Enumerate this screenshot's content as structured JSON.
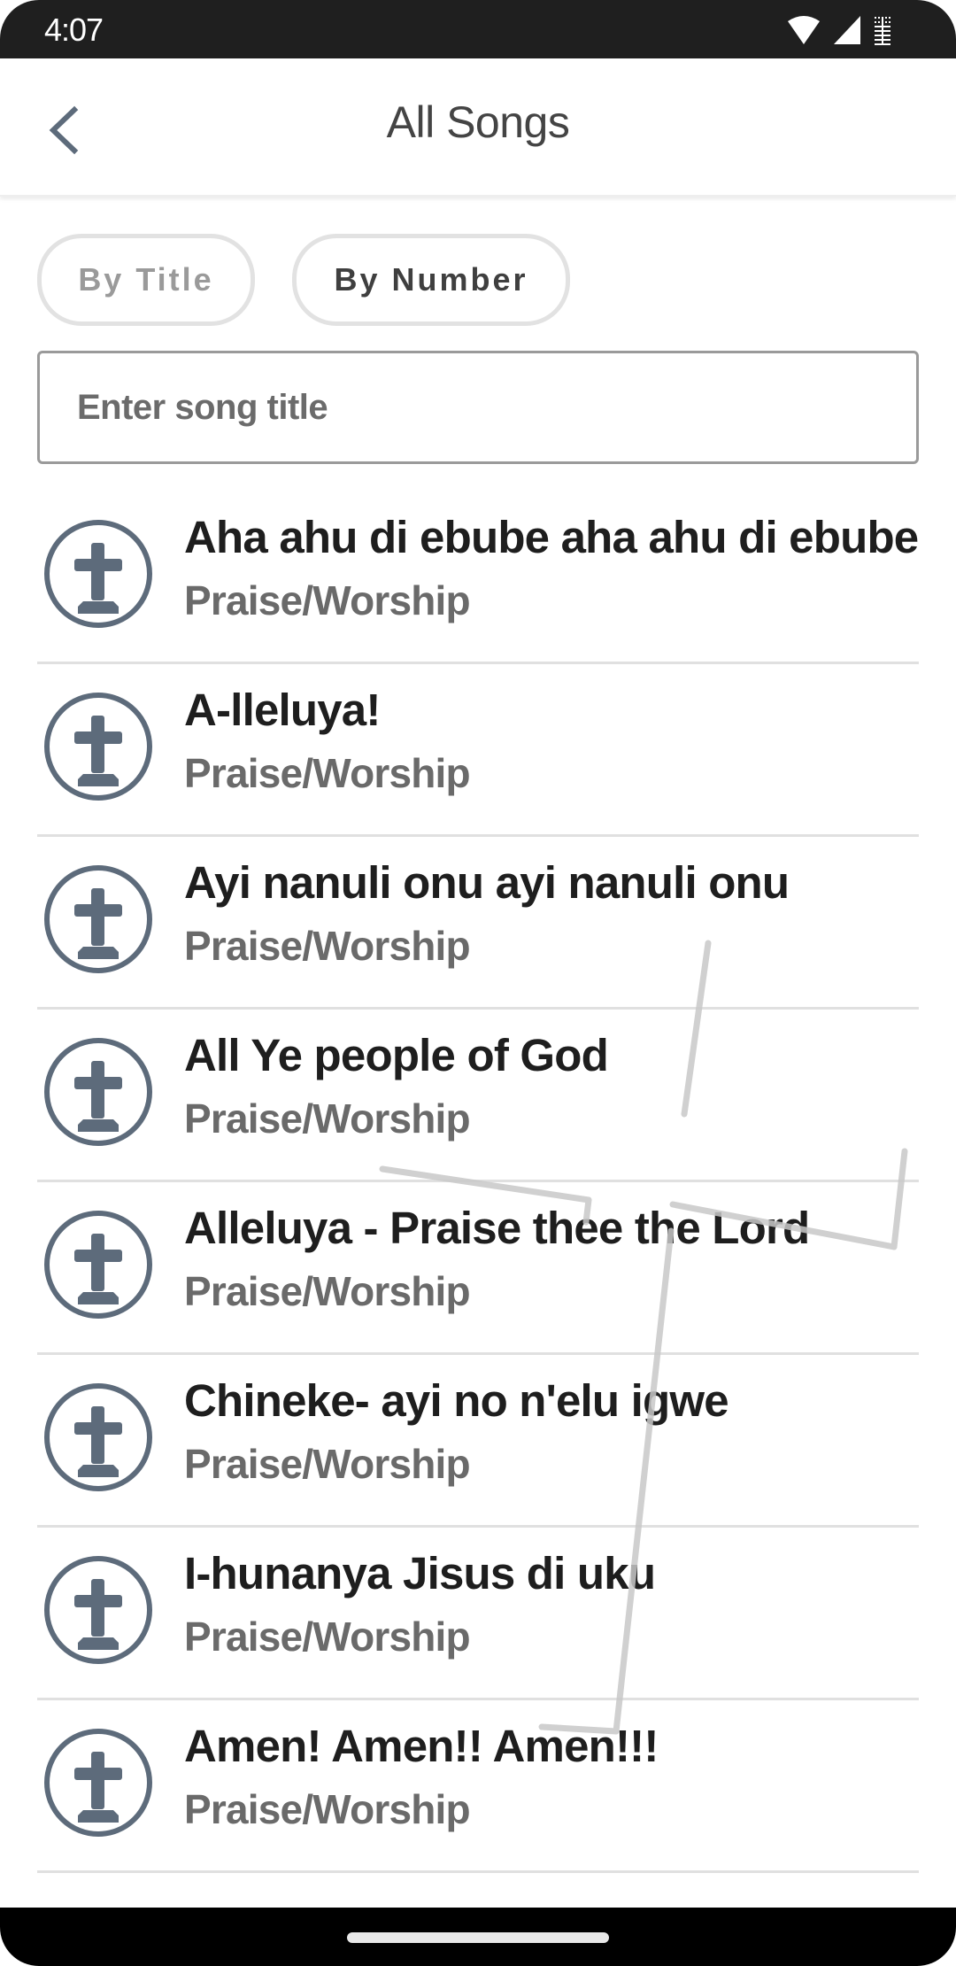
{
  "status_bar": {
    "time": "4:07",
    "icons": [
      "wifi-icon",
      "cell-signal-icon",
      "battery-icon"
    ]
  },
  "header": {
    "back_icon": "chevron-left-icon",
    "title": "All Songs"
  },
  "filters": {
    "by_title_label": "By Title",
    "by_number_label": "By Number",
    "active": "By Number"
  },
  "search": {
    "placeholder": "Enter song title",
    "value": ""
  },
  "colors": {
    "icon": "#5d6b7b",
    "title_text": "#1e1e1e",
    "category_text": "#6a6a6a",
    "divider": "#e0e0e0"
  },
  "songs": [
    {
      "title": "Aha ahu di ebube aha ahu di ebube",
      "category": "Praise/Worship",
      "icon": "cross-icon"
    },
    {
      "title": "A-lleluya!",
      "category": "Praise/Worship",
      "icon": "cross-icon"
    },
    {
      "title": "Ayi nanuli onu ayi nanuli onu",
      "category": "Praise/Worship",
      "icon": "cross-icon"
    },
    {
      "title": "All Ye people of God",
      "category": "Praise/Worship",
      "icon": "cross-icon"
    },
    {
      "title": "Alleluya - Praise thee the Lord",
      "category": "Praise/Worship",
      "icon": "cross-icon"
    },
    {
      "title": "Chineke- ayi no n'elu igwe",
      "category": "Praise/Worship",
      "icon": "cross-icon"
    },
    {
      "title": "I-hunanya Jisus di uku",
      "category": "Praise/Worship",
      "icon": "cross-icon"
    },
    {
      "title": "Amen! Amen!! Amen!!!",
      "category": "Praise/Worship",
      "icon": "cross-icon"
    }
  ]
}
